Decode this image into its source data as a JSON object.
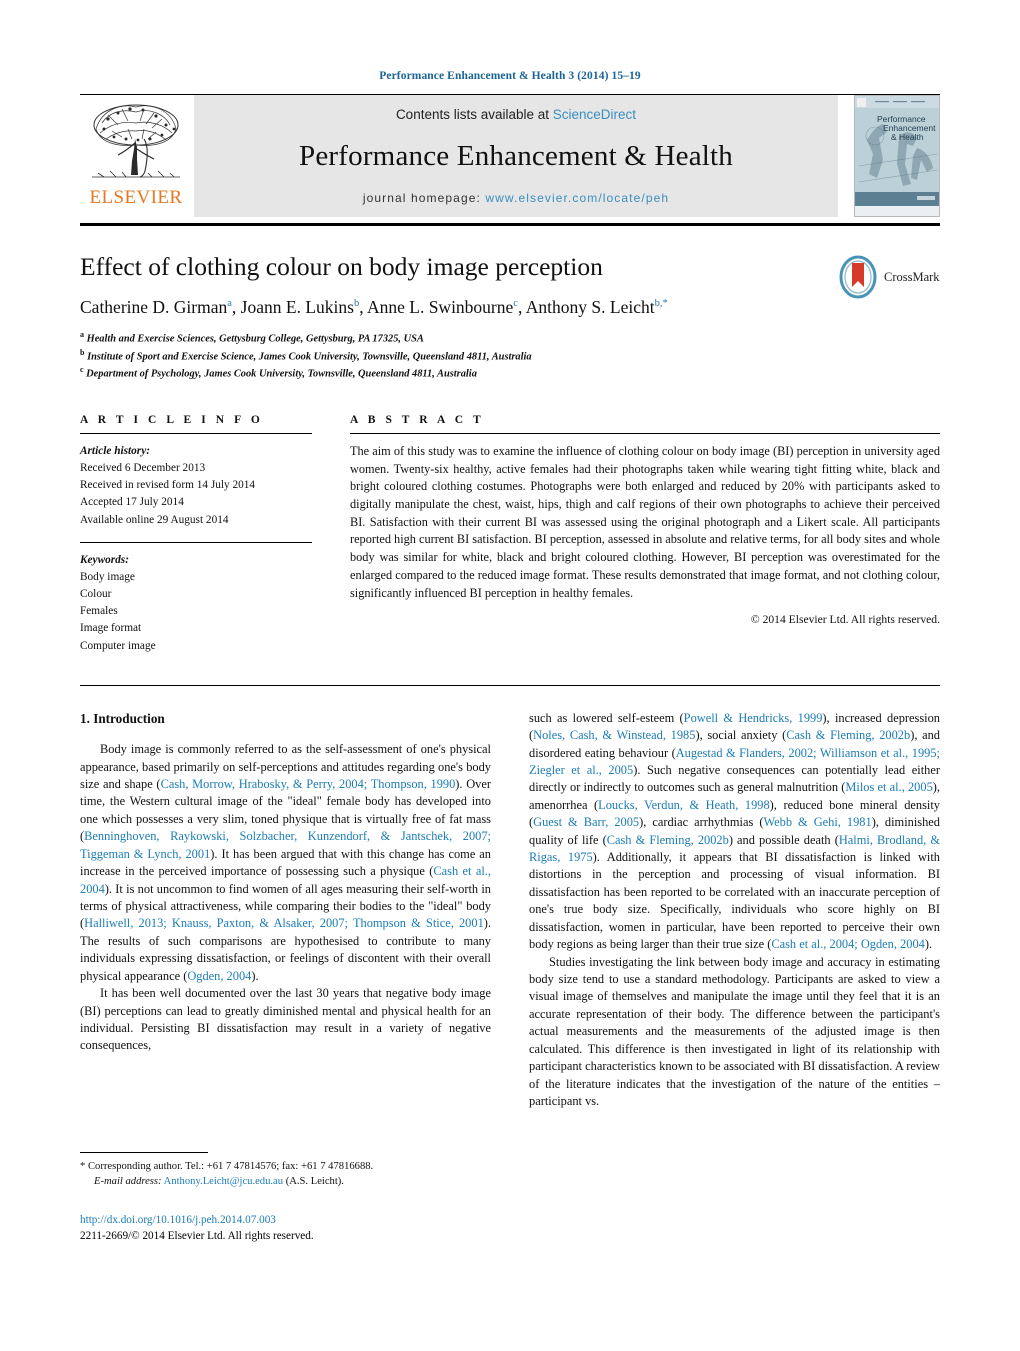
{
  "running_head": "Performance Enhancement & Health 3 (2014) 15–19",
  "masthead": {
    "contents_prefix": "Contents lists available at ",
    "sciencedirect": "ScienceDirect",
    "journal_title": "Performance Enhancement & Health",
    "homepage_prefix": "journal homepage: ",
    "homepage_url": "www.elsevier.com/locate/peh",
    "publisher": "ELSEVIER",
    "cover_title_lines": [
      "Performance",
      "Enhancement",
      "& Health"
    ],
    "colors": {
      "link_blue": "#3a8fc0",
      "elsevier_orange": "#E87722",
      "band_gray": "#e6e6e6",
      "cover_teal": "#b9cdd6"
    }
  },
  "article": {
    "title": "Effect of clothing colour on body image perception",
    "crossmark_label": "CrossMark",
    "authors": [
      {
        "name": "Catherine D. Girman",
        "marks": "a",
        "sep": ", "
      },
      {
        "name": "Joann E. Lukins",
        "marks": "b",
        "sep": ", "
      },
      {
        "name": "Anne L. Swinbourne",
        "marks": "c",
        "sep": ", "
      },
      {
        "name": "Anthony S. Leicht",
        "marks": "b,*",
        "sep": ""
      }
    ],
    "affiliations": [
      {
        "mark": "a",
        "text": "Health and Exercise Sciences, Gettysburg College, Gettysburg, PA 17325, USA"
      },
      {
        "mark": "b",
        "text": "Institute of Sport and Exercise Science, James Cook University, Townsville, Queensland 4811, Australia"
      },
      {
        "mark": "c",
        "text": "Department of Psychology, James Cook University, Townsville, Queensland 4811, Australia"
      }
    ]
  },
  "article_info": {
    "label": "A R T I C L E    I N F O",
    "history_label": "Article history:",
    "history": [
      "Received 6 December 2013",
      "Received in revised form 14 July 2014",
      "Accepted 17 July 2014",
      "Available online 29 August 2014"
    ],
    "keywords_label": "Keywords:",
    "keywords": [
      "Body image",
      "Colour",
      "Females",
      "Image format",
      "Computer image"
    ]
  },
  "abstract": {
    "label": "A B S T R A C T",
    "text": "The aim of this study was to examine the influence of clothing colour on body image (BI) perception in university aged women. Twenty-six healthy, active females had their photographs taken while wearing tight fitting white, black and bright coloured clothing costumes. Photographs were both enlarged and reduced by 20% with participants asked to digitally manipulate the chest, waist, hips, thigh and calf regions of their own photographs to achieve their perceived BI. Satisfaction with their current BI was assessed using the original photograph and a Likert scale. All participants reported high current BI satisfaction. BI perception, assessed in absolute and relative terms, for all body sites and whole body was similar for white, black and bright coloured clothing. However, BI perception was overestimated for the enlarged compared to the reduced image format. These results demonstrated that image format, and not clothing colour, significantly influenced BI perception in healthy females.",
    "copyright": "© 2014 Elsevier Ltd. All rights reserved."
  },
  "introduction": {
    "heading": "1.  Introduction",
    "left_paragraphs": [
      "Body image is commonly referred to as the self-assessment of one's physical appearance, based primarily on self-perceptions and attitudes regarding one's body size and shape (Cash, Morrow, Hrabosky, & Perry, 2004; Thompson, 1990). Over time, the Western cultural image of the \"ideal\" female body has developed into one which possesses a very slim, toned physique that is virtually free of fat mass (Benninghoven, Raykowski, Solzbacher, Kunzendorf, & Jantschek, 2007; Tiggeman & Lynch, 2001). It has been argued that with this change has come an increase in the perceived importance of possessing such a physique (Cash et al., 2004). It is not uncommon to find women of all ages measuring their self-worth in terms of physical attractiveness, while comparing their bodies to the \"ideal\" body (Halliwell, 2013; Knauss, Paxton, & Alsaker, 2007; Thompson & Stice, 2001). The results of such comparisons are hypothesised to contribute to many individuals expressing dissatisfaction, or feelings of discontent with their overall physical appearance (Ogden, 2004).",
      "It has been well documented over the last 30 years that negative body image (BI) perceptions can lead to greatly diminished mental and physical health for an individual. Persisting BI dissatisfaction may result in a variety of negative consequences,"
    ],
    "right_paragraphs": [
      "such as lowered self-esteem (Powell & Hendricks, 1999), increased depression (Noles, Cash, & Winstead, 1985), social anxiety (Cash & Fleming, 2002b), and disordered eating behaviour (Augestad & Flanders, 2002; Williamson et al., 1995; Ziegler et al., 2005). Such negative consequences can potentially lead either directly or indirectly to outcomes such as general malnutrition (Milos et al., 2005), amenorrhea (Loucks, Verdun, & Heath, 1998), reduced bone mineral density (Guest & Barr, 2005), cardiac arrhythmias (Webb & Gehi, 1981), diminished quality of life (Cash & Fleming, 2002b) and possible death (Halmi, Brodland, & Rigas, 1975). Additionally, it appears that BI dissatisfaction is linked with distortions in the perception and processing of visual information. BI dissatisfaction has been reported to be correlated with an inaccurate perception of one's true body size. Specifically, individuals who score highly on BI dissatisfaction, women in particular, have been reported to perceive their own body regions as being larger than their true size (Cash et al., 2004; Ogden, 2004).",
      "Studies investigating the link between body image and accuracy in estimating body size tend to use a standard methodology. Participants are asked to view a visual image of themselves and manipulate the image until they feel that it is an accurate representation of their body. The difference between the participant's actual measurements and the measurements of the adjusted image is then calculated. This difference is then investigated in light of its relationship with participant characteristics known to be associated with BI dissatisfaction. A review of the literature indicates that the investigation of the nature of the entities – participant vs."
    ]
  },
  "footer": {
    "corresponding_marker": "*",
    "corresponding_text": "Corresponding author. Tel.: +61 7 47814576; fax: +61 7 47816688.",
    "email_label": "E-mail address:",
    "email": "Anthony.Leicht@jcu.edu.au",
    "email_suffix": "(A.S. Leicht).",
    "doi": "http://dx.doi.org/10.1016/j.peh.2014.07.003",
    "issn_line": "2211-2669/© 2014 Elsevier Ltd. All rights reserved."
  }
}
